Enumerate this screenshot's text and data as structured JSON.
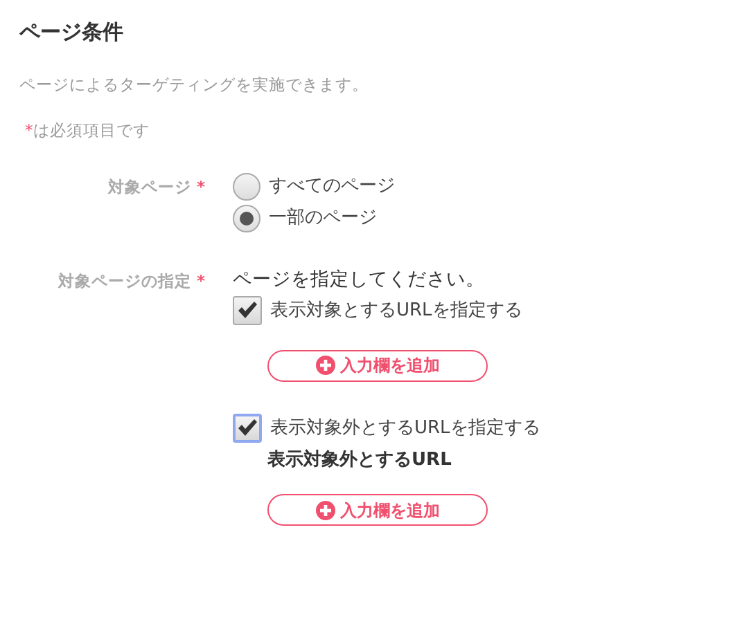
{
  "title": "ページ条件",
  "description": "ページによるターゲティングを実施できます。",
  "required_note": {
    "mark": "*",
    "text": "は必須項目です"
  },
  "fields": [
    {
      "kind": "radio",
      "label": "対象ページ",
      "required_mark": "*",
      "options": [
        {
          "label": "すべてのページ",
          "selected": false
        },
        {
          "label": "一部のページ",
          "selected": true
        }
      ]
    },
    {
      "kind": "url_sections",
      "label": "対象ページの指定",
      "required_mark": "*",
      "instruction": "ページを指定してください。",
      "sections": [
        {
          "label": "表示対象とするURLを指定する",
          "checked": true,
          "focused": false,
          "button": "入力欄を追加"
        },
        {
          "label": "表示対象外とするURLを指定する",
          "checked": true,
          "focused": true,
          "heading": "表示対象外とするURL",
          "button": "入力欄を追加"
        }
      ]
    }
  ]
}
